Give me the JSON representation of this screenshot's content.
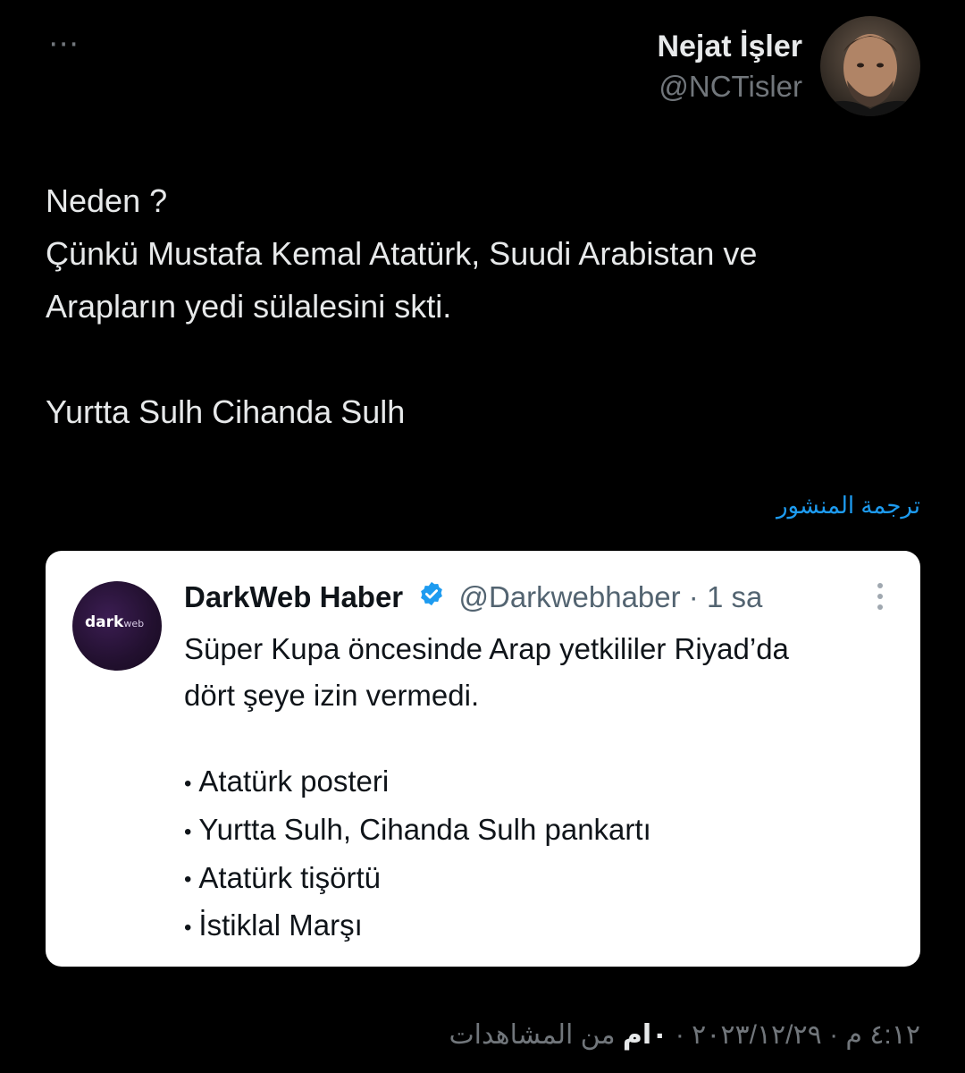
{
  "header": {
    "more_icon": "⋯",
    "author_name": "Nejat İşler",
    "author_handle": "@NCTisler"
  },
  "tweet": {
    "lines": [
      "Neden ?",
      "Çünkü Mustafa Kemal Atatürk, Suudi Arabistan ve",
      "Arapların yedi sülalesini skti.",
      "Yurtta Sulh Cihanda Sulh"
    ],
    "translate_label": "ترجمة المنشور"
  },
  "quote": {
    "avatar_logo": "dark",
    "avatar_logo_sub": "web",
    "name": "DarkWeb Haber",
    "handle": "@Darkwebhaber",
    "separator": "·",
    "time": "1 sa",
    "text_line1": "Süper Kupa öncesinde Arap yetkililer Riyad’da",
    "text_line2": "dört şeye izin vermedi.",
    "bullets": [
      "Atatürk posteri",
      "Yurtta Sulh, Cihanda Sulh pankartı",
      "Atatürk tişörtü",
      "İstiklal Marşı"
    ],
    "bullet_glyph": "•"
  },
  "footer": {
    "timestamp": "٤:١٢ م · ٢٠٢٣/١٢/٢٩ ·",
    "views_count": "٠ام",
    "views_label": "من المشاهدات"
  },
  "colors": {
    "background": "#000000",
    "accent_link": "#1d9bf0",
    "verified": "#1d9bf0"
  }
}
